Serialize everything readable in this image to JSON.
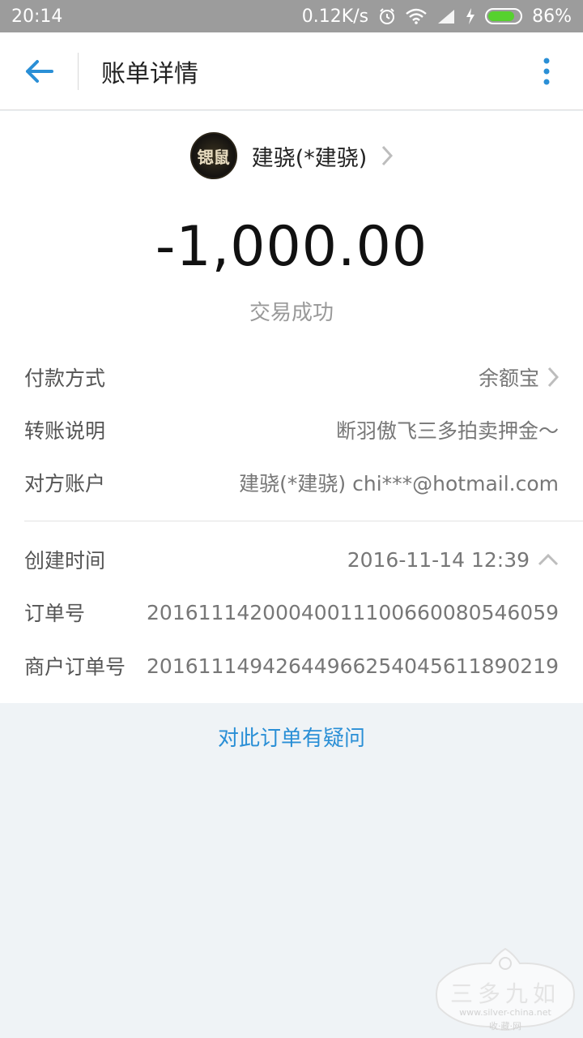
{
  "status_bar": {
    "time": "20:14",
    "net_speed": "0.12K/s",
    "battery": "86%",
    "battery_level": 0.86,
    "battery_color": "#56d12e"
  },
  "header": {
    "title": "账单详情",
    "accent_color": "#2a8fd6"
  },
  "payee": {
    "avatar_text": "锶鼠",
    "name": "建骁(*建骁)"
  },
  "transaction": {
    "amount": "-1,000.00",
    "status": "交易成功"
  },
  "details": [
    {
      "label": "付款方式",
      "value": "余额宝"
    },
    {
      "label": "转账说明",
      "value": "断羽傲飞三多拍卖押金～"
    },
    {
      "label": "对方账户",
      "value": "建骁(*建骁) chi***@hotmail.com"
    }
  ],
  "meta": [
    {
      "label": "创建时间",
      "value": "2016-11-14 12:39"
    },
    {
      "label": "订单号",
      "value": "20161114200040011100660080546059"
    },
    {
      "label": "商户订单号",
      "value": "20161114942644966254045611890219"
    }
  ],
  "question_link": "对此订单有疑问",
  "watermark": {
    "title": "三多九如",
    "url": "www.silver-china.net",
    "sub": "收·藏·网"
  }
}
